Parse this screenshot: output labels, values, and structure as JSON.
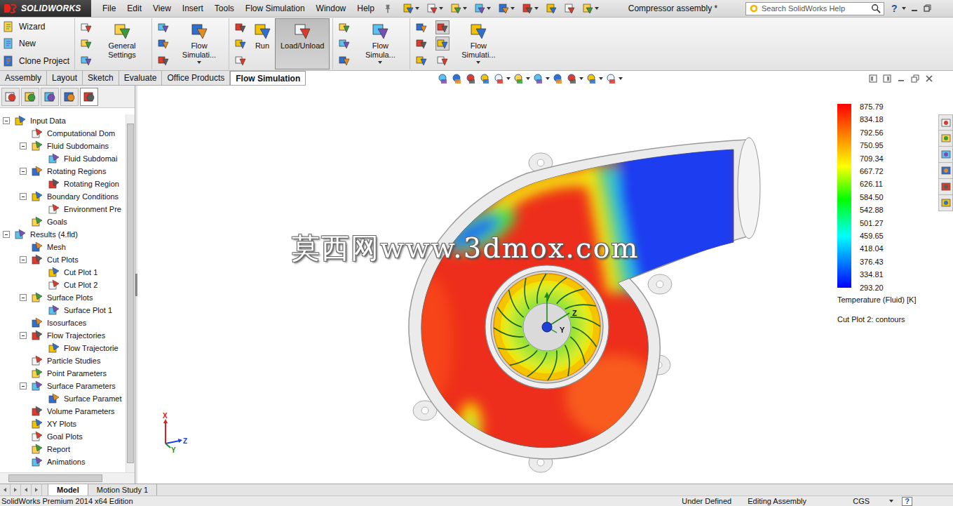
{
  "app": {
    "logo": "SOLIDWORKS",
    "title": "Compressor assembly *",
    "search_placeholder": "Search SolidWorks Help",
    "help": "?"
  },
  "menu": [
    "File",
    "Edit",
    "View",
    "Insert",
    "Tools",
    "Flow Simulation",
    "Window",
    "Help"
  ],
  "ribbon": [
    {
      "kind": "small-list",
      "items": [
        "Wizard",
        "New",
        "Clone Project"
      ]
    },
    {
      "kind": "icon-stack",
      "highlighted": [
        false,
        false,
        false
      ]
    },
    {
      "kind": "button",
      "label": "General Settings",
      "dropdown": false,
      "selected": false
    },
    {
      "kind": "icon-stack",
      "highlighted": [
        false,
        false,
        false
      ]
    },
    {
      "kind": "button",
      "label": "Flow Simulati...",
      "dropdown": true,
      "selected": false
    },
    {
      "kind": "icon-stack",
      "highlighted": [
        false,
        false,
        false
      ]
    },
    {
      "kind": "button",
      "label": "Run",
      "dropdown": false,
      "selected": false
    },
    {
      "kind": "button",
      "label": "Load/Unload",
      "dropdown": false,
      "selected": true
    },
    {
      "kind": "icon-stack",
      "highlighted": [
        false,
        false,
        false
      ]
    },
    {
      "kind": "button",
      "label": "Flow Simula...",
      "dropdown": true,
      "selected": false
    },
    {
      "kind": "icon-stack",
      "highlighted": [
        false,
        false,
        false
      ]
    },
    {
      "kind": "icon-stack",
      "highlighted": [
        true,
        true,
        false
      ]
    },
    {
      "kind": "button",
      "label": "Flow Simulati...",
      "dropdown": true,
      "selected": false
    }
  ],
  "tabs": [
    {
      "label": "Assembly",
      "selected": false
    },
    {
      "label": "Layout",
      "selected": false
    },
    {
      "label": "Sketch",
      "selected": false
    },
    {
      "label": "Evaluate",
      "selected": false
    },
    {
      "label": "Office Products",
      "selected": false
    },
    {
      "label": "Flow Simulation",
      "selected": true
    }
  ],
  "panel_tabs": [
    {
      "selected": false
    },
    {
      "selected": false
    },
    {
      "selected": false
    },
    {
      "selected": false
    },
    {
      "selected": true
    }
  ],
  "tree": [
    {
      "label": "Input Data",
      "level": 0,
      "expandable": true,
      "expanded": true
    },
    {
      "label": "Computational Dom",
      "level": 1,
      "expandable": false,
      "expanded": false
    },
    {
      "label": "Fluid Subdomains",
      "level": 1,
      "expandable": true,
      "expanded": true
    },
    {
      "label": "Fluid Subdomai",
      "level": 2,
      "expandable": false,
      "expanded": false
    },
    {
      "label": "Rotating Regions",
      "level": 1,
      "expandable": true,
      "expanded": true
    },
    {
      "label": "Rotating Region",
      "level": 2,
      "expandable": false,
      "expanded": false
    },
    {
      "label": "Boundary Conditions",
      "level": 1,
      "expandable": true,
      "expanded": true
    },
    {
      "label": "Environment Pre",
      "level": 2,
      "expandable": false,
      "expanded": false
    },
    {
      "label": "Goals",
      "level": 1,
      "expandable": false,
      "expanded": false
    },
    {
      "label": "Results (4.fld)",
      "level": 0,
      "expandable": true,
      "expanded": true
    },
    {
      "label": "Mesh",
      "level": 1,
      "expandable": false,
      "expanded": false
    },
    {
      "label": "Cut Plots",
      "level": 1,
      "expandable": true,
      "expanded": true
    },
    {
      "label": "Cut Plot 1",
      "level": 2,
      "expandable": false,
      "expanded": false
    },
    {
      "label": "Cut Plot 2",
      "level": 2,
      "expandable": false,
      "expanded": false
    },
    {
      "label": "Surface Plots",
      "level": 1,
      "expandable": true,
      "expanded": true
    },
    {
      "label": "Surface Plot 1",
      "level": 2,
      "expandable": false,
      "expanded": false
    },
    {
      "label": "Isosurfaces",
      "level": 1,
      "expandable": false,
      "expanded": false
    },
    {
      "label": "Flow Trajectories",
      "level": 1,
      "expandable": true,
      "expanded": true
    },
    {
      "label": "Flow Trajectorie",
      "level": 2,
      "expandable": false,
      "expanded": false
    },
    {
      "label": "Particle Studies",
      "level": 1,
      "expandable": false,
      "expanded": false
    },
    {
      "label": "Point Parameters",
      "level": 1,
      "expandable": false,
      "expanded": false
    },
    {
      "label": "Surface Parameters",
      "level": 1,
      "expandable": true,
      "expanded": true
    },
    {
      "label": "Surface Paramet",
      "level": 2,
      "expandable": false,
      "expanded": false
    },
    {
      "label": "Volume Parameters",
      "level": 1,
      "expandable": false,
      "expanded": false
    },
    {
      "label": "XY Plots",
      "level": 1,
      "expandable": false,
      "expanded": false
    },
    {
      "label": "Goal Plots",
      "level": 1,
      "expandable": false,
      "expanded": false
    },
    {
      "label": "Report",
      "level": 1,
      "expandable": false,
      "expanded": false
    },
    {
      "label": "Animations",
      "level": 1,
      "expandable": false,
      "expanded": false
    }
  ],
  "tree_scroll": {
    "vertical_level": 0.95,
    "horizontal_level": 0.8
  },
  "legend": {
    "values": [
      "875.79",
      "834.18",
      "792.56",
      "750.95",
      "709.34",
      "667.72",
      "626.11",
      "584.50",
      "542.88",
      "501.27",
      "459.65",
      "418.04",
      "376.43",
      "334.81",
      "293.20"
    ],
    "title": "Temperature (Fluid) [K]",
    "caption": "Cut Plot 2: contours"
  },
  "watermark": "莫西网www.3dmox.com",
  "model_axes": {
    "z": "Z",
    "y": "Y"
  },
  "triad": {
    "x": "X",
    "y": "Y",
    "z": "Z"
  },
  "bottom_tabs": [
    {
      "label": "Model",
      "selected": true
    },
    {
      "label": "Motion Study 1",
      "selected": false
    }
  ],
  "status_bar": {
    "edition": "SolidWorks Premium 2014 x64 Edition",
    "state": "Under Defined",
    "mode": "Editing Assembly",
    "units": "CGS",
    "help": "?"
  }
}
